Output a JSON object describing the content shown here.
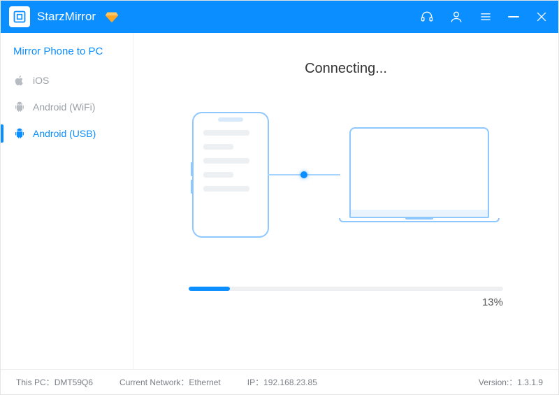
{
  "app": {
    "title": "StarzMirror"
  },
  "sidebar": {
    "title": "Mirror Phone to PC",
    "items": [
      {
        "label": "iOS"
      },
      {
        "label": "Android (WiFi)"
      },
      {
        "label": "Android (USB)"
      }
    ]
  },
  "main": {
    "status": "Connecting...",
    "progress_percent": 13,
    "progress_label": "13%"
  },
  "statusbar": {
    "pc_label": "This PC：",
    "pc_value": "DMT59Q6",
    "net_label": "Current Network：",
    "net_value": "Ethernet",
    "ip_label": "IP：",
    "ip_value": "192.168.23.85",
    "ver_label": "Version:：",
    "ver_value": "1.3.1.9"
  },
  "colors": {
    "accent": "#0b8eff"
  }
}
